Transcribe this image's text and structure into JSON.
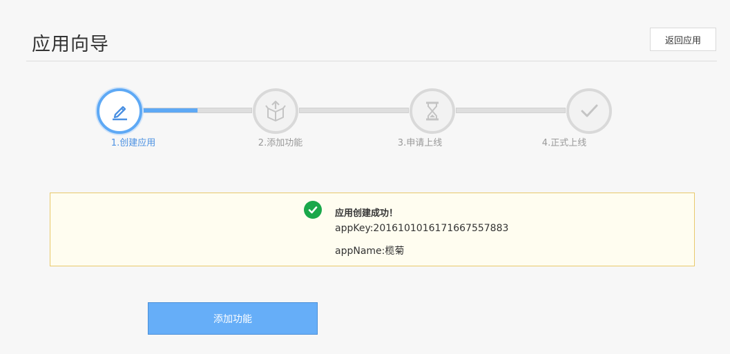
{
  "header": {
    "title": "应用向导",
    "back_button_label": "返回应用"
  },
  "steps": [
    {
      "label": "1.创建应用",
      "icon": "pencil-icon",
      "state": "active"
    },
    {
      "label": "2.添加功能",
      "icon": "box-icon",
      "state": "pending"
    },
    {
      "label": "3.申请上线",
      "icon": "hourglass-icon",
      "state": "pending"
    },
    {
      "label": "4.正式上线",
      "icon": "checkmark-icon",
      "state": "pending"
    }
  ],
  "progress": {
    "first_segment_fill_fraction": 0.5
  },
  "notice": {
    "title": "应用创建成功！",
    "app_key_line": "appKey:2016101016171667557883",
    "app_name_line": "appName:榄菊"
  },
  "actions": {
    "primary_label": "添加功能"
  },
  "colors": {
    "accent": "#5ea9f5",
    "success": "#1aa84b",
    "notice_bg": "#fffdf0",
    "notice_border": "#e8c86a",
    "button_bg": "#66aef8"
  }
}
